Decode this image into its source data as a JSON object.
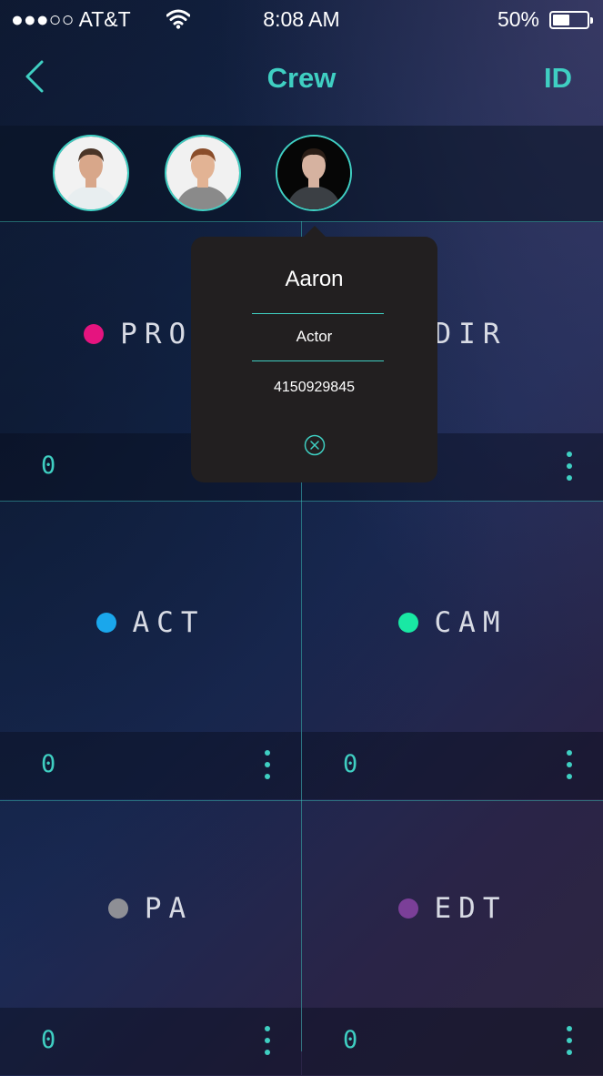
{
  "status_bar": {
    "carrier": "●●●○○ AT&T",
    "time": "8:08 AM",
    "battery": "50%",
    "battery_level": 0.5
  },
  "nav": {
    "title": "Crew",
    "right_button": "ID",
    "back_icon": "chevron-left-icon"
  },
  "avatars": [
    {
      "name": "crew-member-1",
      "shirt": "#e8eef0",
      "skin": "#d8a78a",
      "hair": "#4a3527",
      "bg": "#f2f2f2"
    },
    {
      "name": "crew-member-2",
      "shirt": "#8a8a8a",
      "skin": "#e2b394",
      "hair": "#8a4d2a",
      "bg": "#f1f1f1"
    },
    {
      "name": "crew-member-3",
      "shirt": "#3b3f44",
      "skin": "#d6b2a0",
      "hair": "#2a1d16",
      "bg": "#060606"
    }
  ],
  "departments": [
    {
      "label": "PROD",
      "color": "#e5147f",
      "count": "0"
    },
    {
      "label": "DIR",
      "color": "#5a3a2c",
      "count": "0"
    },
    {
      "label": "ACT",
      "color": "#1aa7ec",
      "count": "0"
    },
    {
      "label": "CAM",
      "color": "#19e8a4",
      "count": "0"
    },
    {
      "label": "PA",
      "color": "#8e8f95",
      "count": "0"
    },
    {
      "label": "EDT",
      "color": "#7b3f98",
      "count": "0"
    }
  ],
  "popup": {
    "name": "Aaron",
    "role": "Actor",
    "phone": "4150929845",
    "close_icon": "close-circle-icon"
  },
  "colors": {
    "accent": "#3fcfc2",
    "popup_bg": "#221f20"
  }
}
